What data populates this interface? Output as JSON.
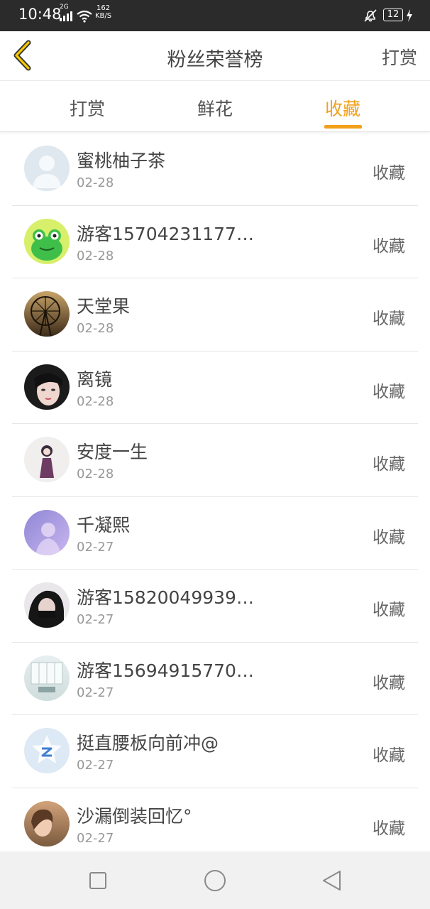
{
  "status_bar": {
    "time": "10:48",
    "network": "2G",
    "speed_value": "162",
    "speed_unit": "KB/S",
    "battery": "12",
    "icons": [
      "signal-icon",
      "wifi-icon",
      "mute-bell-icon",
      "battery-icon",
      "charging-bolt-icon"
    ]
  },
  "header": {
    "title": "粉丝荣誉榜",
    "action": "打赏",
    "back_icon": "chevron-left-icon",
    "accent_color": "#f2a01b"
  },
  "tabs": [
    {
      "label": "打赏",
      "active": false
    },
    {
      "label": "鲜花",
      "active": false
    },
    {
      "label": "收藏",
      "active": true
    }
  ],
  "list": [
    {
      "name": "蜜桃柚子茶",
      "date": "02-28",
      "action": "收藏",
      "avatar": "default-person-avatar"
    },
    {
      "name": "游客15704231177…",
      "date": "02-28",
      "action": "收藏",
      "avatar": "green-frog-avatar"
    },
    {
      "name": "天堂果",
      "date": "02-28",
      "action": "收藏",
      "avatar": "ferris-wheel-avatar"
    },
    {
      "name": "离镜",
      "date": "02-28",
      "action": "收藏",
      "avatar": "girl-portrait-avatar"
    },
    {
      "name": "安度一生",
      "date": "02-28",
      "action": "收藏",
      "avatar": "anime-figure-avatar"
    },
    {
      "name": "千凝熙",
      "date": "02-27",
      "action": "收藏",
      "avatar": "purple-photo-avatar"
    },
    {
      "name": "游客15820049939…",
      "date": "02-27",
      "action": "收藏",
      "avatar": "dark-hair-girl-avatar"
    },
    {
      "name": "游客15694915770…",
      "date": "02-27",
      "action": "收藏",
      "avatar": "window-room-avatar"
    },
    {
      "name": "挺直腰板向前冲@",
      "date": "02-27",
      "action": "收藏",
      "avatar": "qq-logo-avatar"
    },
    {
      "name": "沙漏倒装回忆°",
      "date": "02-27",
      "action": "收藏",
      "avatar": "warm-portrait-avatar"
    }
  ],
  "navbar": {
    "buttons": [
      "recents-square-icon",
      "home-circle-icon",
      "back-triangle-icon"
    ]
  }
}
